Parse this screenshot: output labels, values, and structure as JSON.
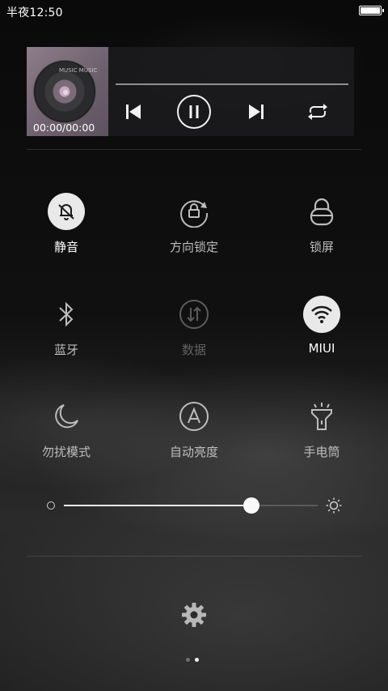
{
  "status_bar": {
    "time": "半夜12:50",
    "battery_level": 1.0
  },
  "media_player": {
    "time_display": "00:00/00:00",
    "album_art_text": "MUSIC MUSIC",
    "progress": 0.0,
    "controls": [
      "previous-icon",
      "pause-icon",
      "next-icon",
      "repeat-icon"
    ]
  },
  "toggles": [
    {
      "label": "静音",
      "icon": "mute-bell-icon",
      "active": true
    },
    {
      "label": "方向锁定",
      "icon": "rotation-lock-icon",
      "active": false
    },
    {
      "label": "锁屏",
      "icon": "lock-icon",
      "active": false
    },
    {
      "label": "蓝牙",
      "icon": "bluetooth-icon",
      "active": false
    },
    {
      "label": "数据",
      "icon": "mobile-data-icon",
      "active": false,
      "disabled": true
    },
    {
      "label": "MIUI",
      "icon": "wifi-icon",
      "active": true
    },
    {
      "label": "勿扰模式",
      "icon": "moon-icon",
      "active": false
    },
    {
      "label": "自动亮度",
      "icon": "auto-brightness-icon",
      "active": false
    },
    {
      "label": "手电筒",
      "icon": "flashlight-icon",
      "active": false
    }
  ],
  "brightness": {
    "level": 0.74,
    "low_icon": "brightness-low-icon",
    "high_icon": "brightness-high-icon"
  },
  "settings_icon": "gear-icon",
  "pagination": {
    "pages": 2,
    "current": 2
  },
  "colors": {
    "active_circle": "#e9e9e9",
    "label_active": "#ffffff",
    "label_inactive": "#bdbdbd",
    "label_disabled": "#626262"
  }
}
